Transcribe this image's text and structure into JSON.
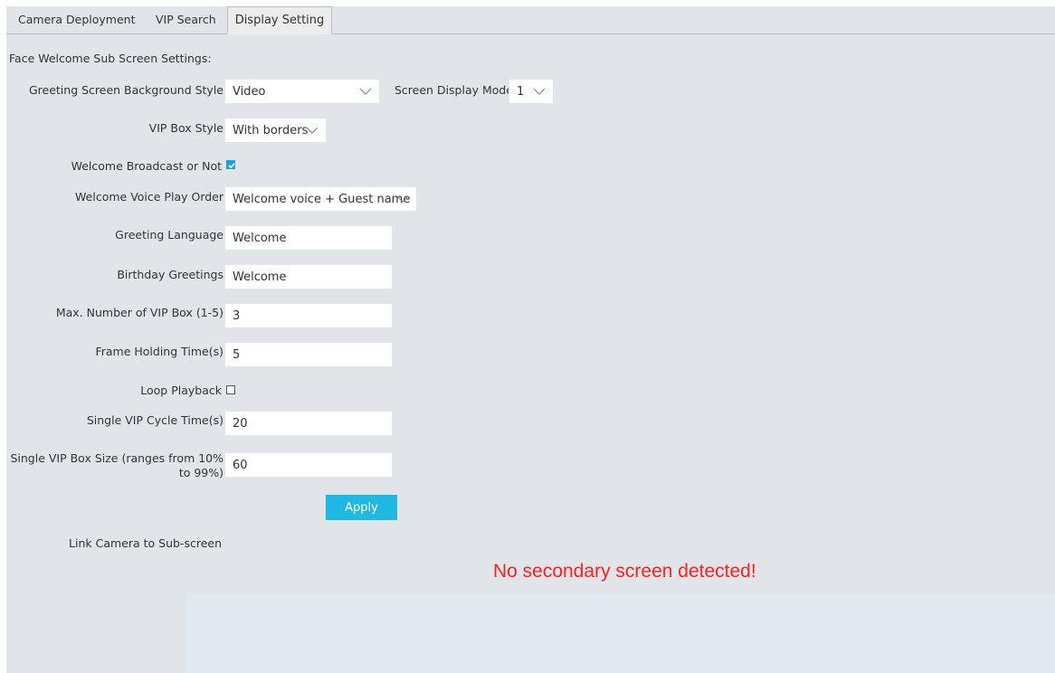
{
  "tabs": [
    {
      "label": "Camera Deployment",
      "active": false
    },
    {
      "label": "VIP Search",
      "active": false
    },
    {
      "label": "Display Setting",
      "active": true
    }
  ],
  "section_title": "Face Welcome Sub Screen Settings:",
  "form": {
    "greeting_bg_style": {
      "label": "Greeting Screen Background Style",
      "value": "Video"
    },
    "screen_display_mode": {
      "label": "Screen Display Mode",
      "value": "1"
    },
    "vip_box_style": {
      "label": "VIP Box Style",
      "value": "With borders"
    },
    "welcome_broadcast": {
      "label": "Welcome Broadcast or Not",
      "checked": true
    },
    "voice_play_order": {
      "label": "Welcome Voice Play Order",
      "value": "Welcome voice + Guest name"
    },
    "greeting_language": {
      "label": "Greeting Language",
      "value": "Welcome"
    },
    "birthday_greetings": {
      "label": "Birthday Greetings",
      "value": "Welcome"
    },
    "max_vip_box": {
      "label": "Max. Number of VIP Box (1-5)",
      "value": "3"
    },
    "frame_holding_time": {
      "label": "Frame Holding Time(s)",
      "value": "5"
    },
    "loop_playback": {
      "label": "Loop Playback",
      "checked": false
    },
    "single_vip_cycle": {
      "label": "Single VIP Cycle Time(s)",
      "value": "20"
    },
    "single_vip_box_size": {
      "label": "Single VIP Box Size (ranges from 10% to 99%)",
      "value": "60"
    },
    "apply_label": "Apply"
  },
  "link_camera_label": "Link Camera to Sub-screen",
  "no_screen_message": "No secondary screen detected!",
  "colors": {
    "accent": "#1fb8e3",
    "checkbox": "#1aa3d9",
    "error": "#ff2020",
    "background": "#e1e5e9",
    "preview_area": "#dfe9ef"
  },
  "icons": {
    "dropdown": "chevron-down-icon",
    "check": "checkmark-icon"
  }
}
